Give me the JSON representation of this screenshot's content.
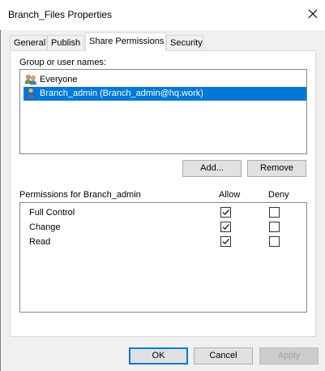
{
  "window": {
    "title": "Branch_Files Properties"
  },
  "tabs": [
    {
      "label": "General"
    },
    {
      "label": "Publish"
    },
    {
      "label": "Share Permissions",
      "active": true
    },
    {
      "label": "Security"
    }
  ],
  "groups": {
    "label": "Group or user names:",
    "items": [
      {
        "name": "Everyone",
        "icon": "users-group-icon",
        "selected": false
      },
      {
        "name": "Branch_admin (Branch_admin@hq.work)",
        "icon": "user-icon",
        "selected": true
      }
    ]
  },
  "group_buttons": {
    "add": "Add...",
    "remove": "Remove"
  },
  "permissions": {
    "label": "Permissions for Branch_admin",
    "allow_header": "Allow",
    "deny_header": "Deny",
    "rows": [
      {
        "name": "Full Control",
        "allow": true,
        "deny": false
      },
      {
        "name": "Change",
        "allow": true,
        "deny": false
      },
      {
        "name": "Read",
        "allow": true,
        "deny": false
      }
    ]
  },
  "footer": {
    "ok": "OK",
    "cancel": "Cancel",
    "apply": "Apply"
  },
  "colors": {
    "selection": "#0078d7",
    "panel_bg": "#f0f0f0"
  }
}
